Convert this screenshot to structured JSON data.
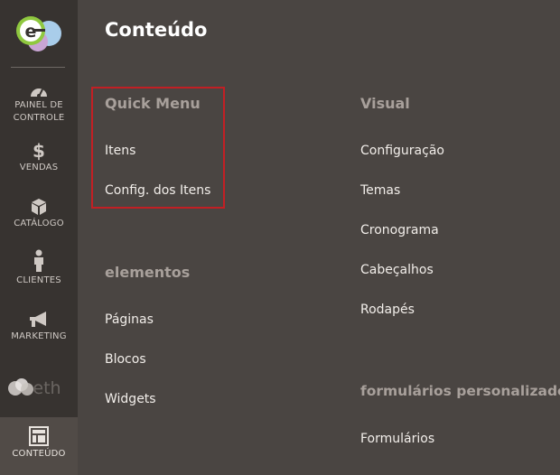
{
  "sidebar": {
    "logo_letter": "e",
    "items": [
      {
        "label_line1": "PAINEL DE",
        "label_line2": "CONTROLE",
        "icon": "dashboard-icon"
      },
      {
        "label": "VENDAS",
        "icon": "dollar-icon"
      },
      {
        "label": "CATÁLOGO",
        "icon": "box-icon"
      },
      {
        "label": "CLIENTES",
        "icon": "person-icon"
      },
      {
        "label": "MARKETING",
        "icon": "megaphone-icon"
      },
      {
        "label": "CONTEÚDO",
        "icon": "layout-icon",
        "active": true
      }
    ],
    "brand_text": "eth"
  },
  "page": {
    "title": "Conteúdo"
  },
  "sections": {
    "quick_menu": {
      "title": "Quick Menu",
      "links": [
        "Itens",
        "Config. dos Itens"
      ]
    },
    "elementos": {
      "title": "elementos",
      "links": [
        "Páginas",
        "Blocos",
        "Widgets"
      ]
    },
    "visual": {
      "title": "Visual",
      "links": [
        "Configuração",
        "Temas",
        "Cronograma",
        "Cabeçalhos",
        "Rodapés"
      ]
    },
    "formularios": {
      "title": "formulários personalizados",
      "links": [
        "Formulários"
      ]
    }
  },
  "colors": {
    "sidebar_bg": "#373330",
    "content_bg": "#4a4542",
    "highlight_border": "#c21f24"
  }
}
